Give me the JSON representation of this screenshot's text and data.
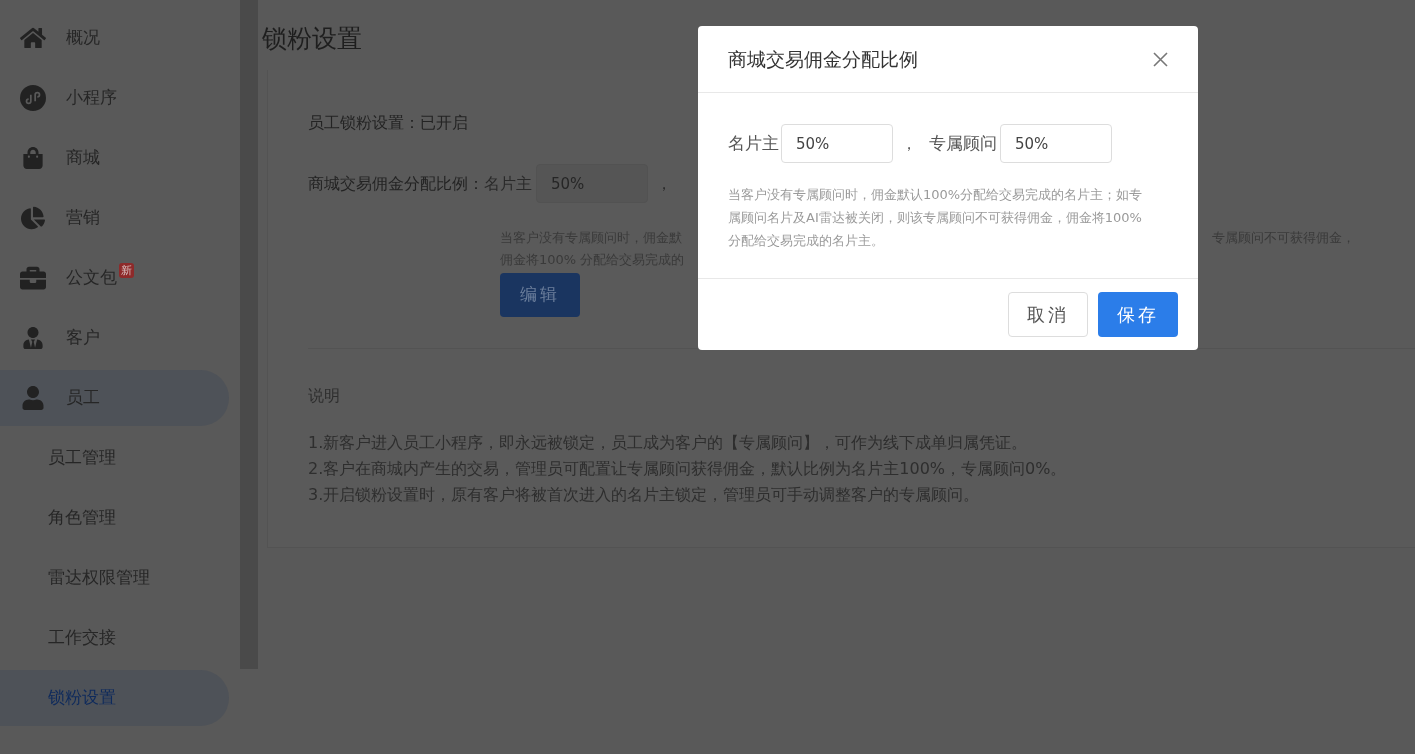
{
  "sidebar": {
    "items": [
      {
        "label": "概况",
        "selected": false
      },
      {
        "label": "小程序",
        "selected": false
      },
      {
        "label": "商城",
        "selected": false
      },
      {
        "label": "营销",
        "selected": false
      },
      {
        "label": "公文包",
        "selected": false,
        "badge": "新"
      },
      {
        "label": "客户",
        "selected": false
      },
      {
        "label": "员工",
        "selected": false,
        "expanded": true,
        "children": [
          {
            "label": "员工管理",
            "selected": false
          },
          {
            "label": "角色管理",
            "selected": false
          },
          {
            "label": "雷达权限管理",
            "selected": false
          },
          {
            "label": "工作交接",
            "selected": false
          },
          {
            "label": "锁粉设置",
            "selected": true
          }
        ]
      }
    ]
  },
  "page": {
    "title": "锁粉设置",
    "status": "员工锁粉设置：已开启",
    "ratio_row": {
      "label": "商城交易佣金分配比例：",
      "owner_label": "名片主",
      "owner_value": "50%",
      "owner_disabled": true,
      "separator": "，"
    },
    "hint_left": [
      "当客户没有专属顾问时，佣金默",
      "佣金将100% 分配给交易完成的"
    ],
    "hint_right": "专属顾问不可获得佣金，",
    "edit_button": "编辑",
    "notes_title": "说明",
    "notes": [
      "1.新客户进入员工小程序，即永远被锁定，员工成为客户的【专属顾问】，可作为线下成单归属凭证。",
      "2.客户在商城内产生的交易，管理员可配置让专属顾问获得佣金，默认比例为名片主100%，专属顾问0%。",
      "3.开启锁粉设置时，原有客户将被首次进入的名片主锁定，管理员可手动调整客户的专属顾问。"
    ]
  },
  "dialog": {
    "title": "商城交易佣金分配比例",
    "owner_label": "名片主",
    "owner_value": "50%",
    "separator": "，",
    "advisor_label": "专属顾问",
    "advisor_value": "50%",
    "hint": "当客户没有专属顾问时，佣金默认100%分配给交易完成的名片主；如专属顾问名片及AI雷达被关闭，则该专属顾问不可获得佣金，佣金将100% 分配给交易完成的名片主。",
    "cancel_button": "取消",
    "save_button": "保存"
  }
}
